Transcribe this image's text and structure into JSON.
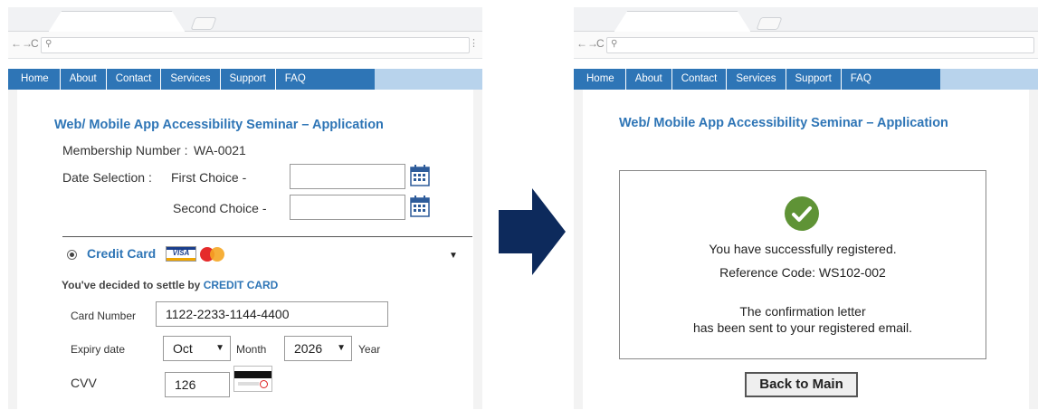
{
  "left_page": {
    "nav": [
      "Home",
      "About",
      "Contact",
      "Services",
      "Support",
      "FAQ"
    ],
    "title": "Web/ Mobile App Accessibility Seminar – Application",
    "membership_label": "Membership Number :",
    "membership_value": "WA-0021",
    "date_label": "Date Selection :",
    "first_choice_label": "First Choice -",
    "first_choice_value": "",
    "second_choice_label": "Second Choice -",
    "second_choice_value": "",
    "payment_option_label": "Credit Card",
    "visa_text": "VISA",
    "dropdown_caret": "▼",
    "settle_prefix": "You've decided to settle by",
    "settle_method": "CREDIT CARD",
    "card_number_label": "Card Number",
    "card_number_value": "1122-2233-1144-4400",
    "expiry_label": "Expiry date",
    "expiry_month_value": "Oct",
    "month_label": "Month",
    "expiry_year_value": "2026",
    "year_label": "Year",
    "cvv_label": "CVV",
    "cvv_value": "126"
  },
  "right_page": {
    "nav": [
      "Home",
      "About",
      "Contact",
      "Services",
      "Support",
      "FAQ"
    ],
    "title": "Web/ Mobile App Accessibility Seminar – Application",
    "success_message": "You have successfully registered.",
    "reference_line": "Reference Code: WS102-002",
    "confirmation_line1": "The confirmation letter",
    "confirmation_line2": "has been sent to your registered email.",
    "back_button": "Back to Main"
  },
  "browser": {
    "nav_icons": [
      "back-arrow-icon",
      "forward-arrow-icon",
      "reload-icon",
      "search-icon",
      "menu-dots-icon"
    ]
  },
  "colors": {
    "nav_bar": "#2e75b6",
    "nav_bar_extension": "#b8d3ec",
    "title": "#2e75b6",
    "success_check": "#5f9336",
    "flow_arrow": "#0d2a5c"
  }
}
